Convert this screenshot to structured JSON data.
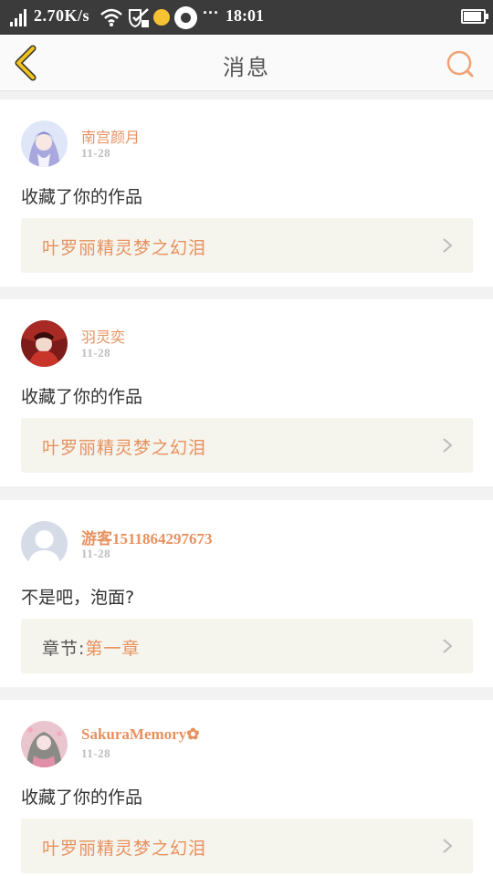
{
  "status_bar": {
    "speed": "2.70K/s",
    "more": "···",
    "time": "18:01"
  },
  "header": {
    "title": "消息",
    "back_icon": "chevron-left-icon",
    "search_icon": "search-icon"
  },
  "colors": {
    "accent": "#e8915f",
    "back_yellow": "#f0c21a",
    "ref_bg": "#f5f4ed"
  },
  "messages": [
    {
      "username": "南宫颜月",
      "date": "11-28",
      "text": "收藏了你的作品",
      "ref_label": "",
      "ref_value": "叶罗丽精灵梦之幻泪"
    },
    {
      "username": "羽灵奕",
      "date": "11-28",
      "text": "收藏了你的作品",
      "ref_label": "",
      "ref_value": "叶罗丽精灵梦之幻泪"
    },
    {
      "username": "游客1511864297673",
      "date": "11-28",
      "text": "不是吧，泡面?",
      "ref_label": "章节:",
      "ref_value": "第一章"
    },
    {
      "username": "SakuraMemory✿",
      "date": "11-28",
      "text": "收藏了你的作品",
      "ref_label": "",
      "ref_value": "叶罗丽精灵梦之幻泪"
    }
  ]
}
